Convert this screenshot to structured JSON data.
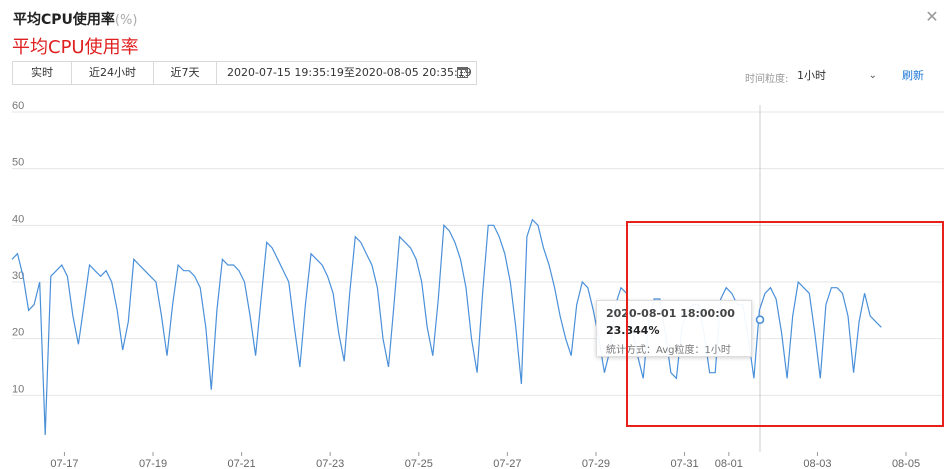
{
  "window": {
    "title": "平均CPU使用率",
    "unit": "(%)",
    "close_glyph": "✕"
  },
  "annotation_text": "平均CPU使用率",
  "toolbar": {
    "realtime_label": "实时",
    "last24h_label": "近24小时",
    "last7d_label": "近7天",
    "date_range": "2020-07-15 19:35:19至2020-08-05 20:35:19"
  },
  "granularity": {
    "label": "时间粒度:",
    "value": "1小时"
  },
  "refresh_label": "刷新",
  "tooltip": {
    "time": "2020-08-01 18:00:00",
    "value": "23.344%",
    "stat": "統计方式：Avg粒度：1小时"
  },
  "colors": {
    "line": "#4a90d9",
    "grid": "#e6e6e6",
    "highlight": "#e8201c",
    "link": "#1e78d8"
  },
  "chart_data": {
    "type": "line",
    "ylim": [
      0,
      60
    ],
    "yticks": [
      10,
      20,
      30,
      40,
      50,
      60
    ],
    "xticks": [
      "07-17",
      "07-19",
      "07-21",
      "07-23",
      "07-25",
      "07-27",
      "07-29",
      "07-31",
      "08-01",
      "08-03",
      "08-05"
    ],
    "x_range": [
      "2020-07-15 19:35",
      "2020-08-05 20:35"
    ],
    "series": [
      {
        "x_start": "2020-07-15 19:35",
        "step_hours": 3,
        "values": [
          34,
          35,
          31,
          25,
          26,
          30,
          3,
          31,
          32,
          33,
          31,
          24,
          19,
          26,
          33,
          32,
          31,
          32,
          30,
          25,
          18,
          23,
          34,
          33,
          32,
          31,
          30,
          24,
          17,
          26,
          33,
          32,
          32,
          31,
          29,
          22,
          11,
          25,
          34,
          33,
          33,
          32,
          30,
          24,
          17,
          27,
          37,
          36,
          34,
          32,
          30,
          22,
          15,
          26,
          35,
          34,
          33,
          31,
          28,
          21,
          16,
          28,
          38,
          37,
          35,
          33,
          29,
          20,
          15,
          26,
          38,
          37,
          36,
          34,
          30,
          22,
          17,
          27,
          40,
          39,
          37,
          34,
          29,
          20,
          14,
          28,
          40,
          40,
          38,
          35,
          30,
          22,
          12,
          38,
          41,
          40,
          36,
          33,
          29,
          24,
          20,
          17,
          26,
          30,
          29,
          25,
          20,
          14,
          18,
          26,
          29,
          28,
          22,
          17,
          13,
          23,
          27,
          27,
          21,
          14,
          13,
          22,
          25,
          26,
          26,
          21,
          14,
          14,
          27,
          29,
          28,
          26,
          26,
          20,
          13,
          25,
          28,
          29,
          27,
          21,
          13,
          24,
          30,
          29,
          28,
          21,
          13,
          26,
          29,
          29,
          28,
          24,
          14,
          23,
          28,
          24,
          23,
          22
        ]
      }
    ]
  }
}
